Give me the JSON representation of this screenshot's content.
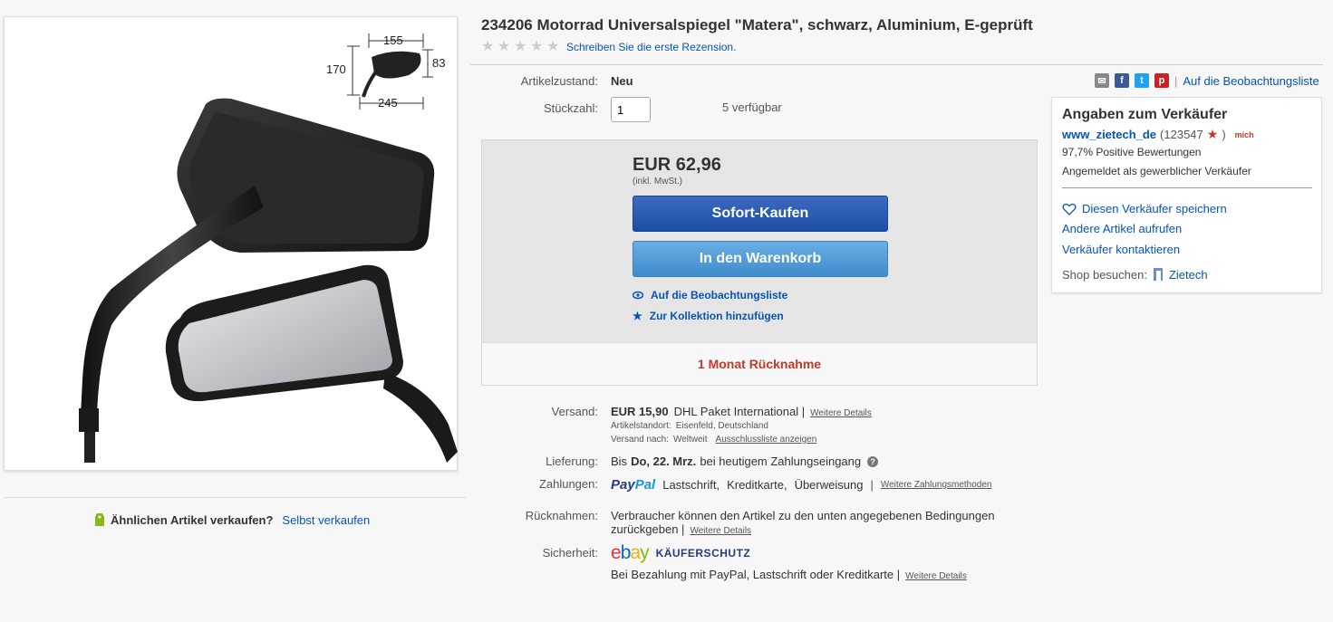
{
  "product": {
    "title": "234206 Motorrad Universalspiegel \"Matera\", schwarz, Aluminium, E-geprüft",
    "review_link": "Schreiben Sie die erste Rezension.",
    "dimensions": {
      "width_top": "155",
      "height_left": "170",
      "height_right": "83",
      "width_bottom": "245"
    }
  },
  "condition": {
    "label": "Artikelzustand:",
    "value": "Neu"
  },
  "quantity": {
    "label": "Stückzahl:",
    "value": "1",
    "available": "5 verfügbar"
  },
  "buybox": {
    "price": "EUR 62,96",
    "price_note": "(inkl. MwSt.)",
    "buy_now": "Sofort-Kaufen",
    "add_to_cart": "In den Warenkorb",
    "watch": "Auf die Beobachtungsliste",
    "collection": "Zur Kollektion hinzufügen",
    "returns_badge": "1 Monat Rücknahme"
  },
  "share": {
    "watch_link": "Auf die Beobachtungsliste"
  },
  "seller": {
    "heading": "Angaben zum Verkäufer",
    "name": "www_zietech_de",
    "score": "(123547",
    "score_close": ")",
    "me_badge": "mich",
    "positive": "97,7% Positive Bewertungen",
    "registered": "Angemeldet als gewerblicher Verkäufer",
    "save": "Diesen Verkäufer speichern",
    "other_items": "Andere Artikel aufrufen",
    "contact": "Verkäufer kontaktieren",
    "shop_label": "Shop besuchen:",
    "shop_name": "Zietech"
  },
  "shipping": {
    "label": "Versand:",
    "price": "EUR 15,90",
    "service": "DHL Paket International |",
    "details": "Weitere Details",
    "location_label": "Artikelstandort:",
    "location": "Eisenfeld, Deutschland",
    "ships_to_label": "Versand nach:",
    "ships_to": "Weltweit",
    "exclusions": "Ausschlussliste anzeigen"
  },
  "delivery": {
    "label": "Lieferung:",
    "prefix": "Bis",
    "date": "Do, 22. Mrz.",
    "suffix": "bei heutigem Zahlungseingang"
  },
  "payments": {
    "label": "Zahlungen:",
    "paypal_a": "Pay",
    "paypal_b": "Pal",
    "methods": [
      "Lastschrift,",
      "Kreditkarte,",
      "Überweisung"
    ],
    "separator": "|",
    "more": "Weitere Zahlungsmethoden"
  },
  "returns": {
    "label": "Rücknahmen:",
    "line1": "Verbraucher können den Artikel zu den unten angegebenen Bedingungen",
    "line2": "zurückgeben |",
    "details": "Weitere Details"
  },
  "security": {
    "label": "Sicherheit:",
    "ebay_e": "e",
    "ebay_b": "b",
    "ebay_a": "a",
    "ebay_y": "y",
    "buyer_protection": "KÄUFERSCHUTZ",
    "note": "Bei Bezahlung mit PayPal, Lastschrift oder Kreditkarte |",
    "details": "Weitere Details"
  },
  "sell_similar": {
    "question": "Ähnlichen Artikel verkaufen?",
    "link": "Selbst verkaufen"
  },
  "colors": {
    "link": "#0654ba",
    "buy": "#1e4da6",
    "cart": "#3f8ccc",
    "returns": "#c0392b"
  }
}
